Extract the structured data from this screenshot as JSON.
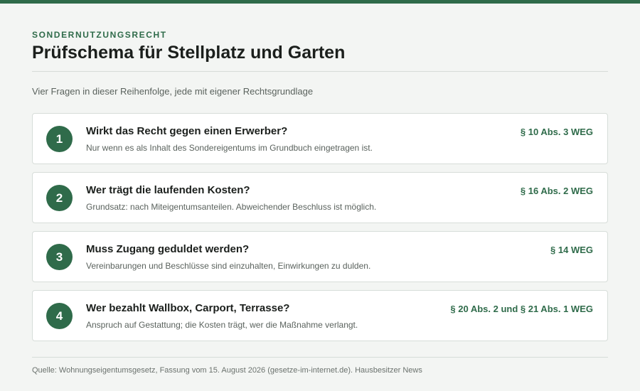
{
  "header": {
    "kicker": "SONDERNUTZUNGSRECHT",
    "title": "Prüfschema für Stellplatz und Garten",
    "subtitle": "Vier Fragen in dieser Reihenfolge, jede mit eigener Rechtsgrundlage"
  },
  "steps": [
    {
      "number": "1",
      "question": "Wirkt das Recht gegen einen Erwerber?",
      "detail": "Nur wenn es als Inhalt des Sondereigentums im Grundbuch eingetragen ist.",
      "law": "§ 10 Abs. 3 WEG"
    },
    {
      "number": "2",
      "question": "Wer trägt die laufenden Kosten?",
      "detail": "Grundsatz: nach Miteigentumsanteilen. Abweichender Beschluss ist möglich.",
      "law": "§ 16 Abs. 2 WEG"
    },
    {
      "number": "3",
      "question": "Muss Zugang geduldet werden?",
      "detail": "Vereinbarungen und Beschlüsse sind einzuhalten, Einwirkungen zu dulden.",
      "law": "§ 14 WEG"
    },
    {
      "number": "4",
      "question": "Wer bezahlt Wallbox, Carport, Terrasse?",
      "detail": "Anspruch auf Gestattung; die Kosten trägt, wer die Maßnahme verlangt.",
      "law": "§ 20 Abs. 2 und § 21 Abs. 1 WEG"
    }
  ],
  "footer": {
    "source": "Quelle: Wohnungseigentumsgesetz, Fassung vom 15. August 2026 (gesetze-im-internet.de). Hausbesitzer News"
  },
  "colors": {
    "accent": "#2f6b4a",
    "background": "#f3f5f3",
    "card": "#ffffff"
  }
}
